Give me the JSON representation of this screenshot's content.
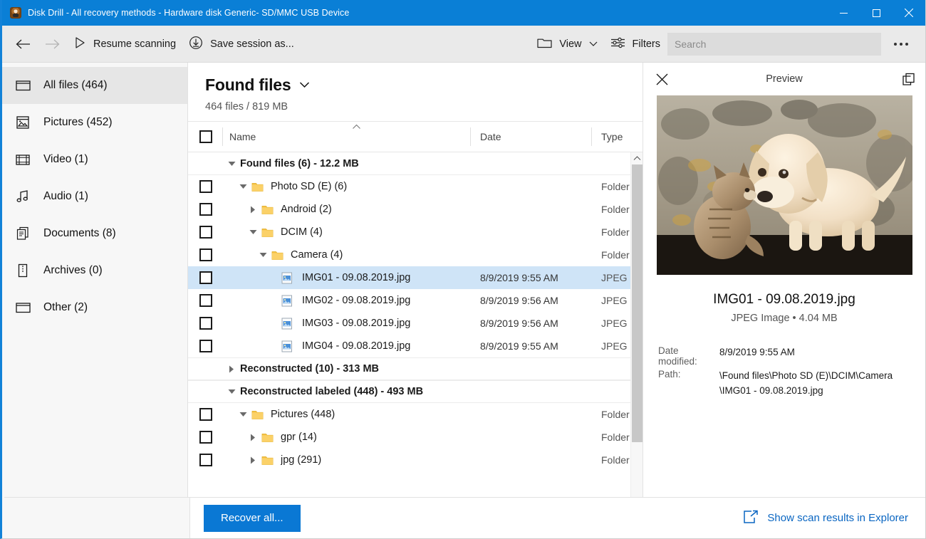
{
  "window": {
    "title": "Disk Drill - All recovery methods - Hardware disk Generic- SD/MMC USB Device",
    "minimize_label": "─",
    "maximize_label": "□",
    "close_label": "✕",
    "accent_color": "#0a7fd6"
  },
  "toolbar": {
    "back_label": "←",
    "forward_label": "→",
    "resume_label": "Resume scanning",
    "save_session_label": "Save session as...",
    "view_label": "View",
    "filters_label": "Filters",
    "search_placeholder": "Search",
    "search_value": "",
    "more_label": "•••"
  },
  "sidebar": {
    "items": [
      {
        "label": "All files (464)",
        "icon": "all-files-icon",
        "active": true
      },
      {
        "label": "Pictures (452)",
        "icon": "pictures-icon",
        "active": false
      },
      {
        "label": "Video (1)",
        "icon": "video-icon",
        "active": false
      },
      {
        "label": "Audio (1)",
        "icon": "audio-icon",
        "active": false
      },
      {
        "label": "Documents (8)",
        "icon": "documents-icon",
        "active": false
      },
      {
        "label": "Archives (0)",
        "icon": "archives-icon",
        "active": false
      },
      {
        "label": "Other (2)",
        "icon": "other-icon",
        "active": false
      }
    ]
  },
  "main": {
    "heading": "Found files",
    "heading_chevron": "⌄",
    "subheading": "464 files / 819 MB",
    "columns": {
      "name": "Name",
      "date": "Date",
      "type": "Type"
    },
    "sort_indicator": "⌃",
    "rows": [
      {
        "kind": "group",
        "indent": 0,
        "twisty": "down",
        "label": "Found files (6) - 12.2 MB",
        "date": "",
        "type": "",
        "checkbox": false,
        "selected": false,
        "first": true
      },
      {
        "kind": "folder",
        "indent": 1,
        "twisty": "down",
        "label": "Photo SD (E) (6)",
        "date": "",
        "type": "Folder",
        "checkbox": true,
        "selected": false
      },
      {
        "kind": "folder",
        "indent": 2,
        "twisty": "right",
        "label": "Android (2)",
        "date": "",
        "type": "Folder",
        "checkbox": true,
        "selected": false
      },
      {
        "kind": "folder",
        "indent": 2,
        "twisty": "down",
        "label": "DCIM (4)",
        "date": "",
        "type": "Folder",
        "checkbox": true,
        "selected": false
      },
      {
        "kind": "folder",
        "indent": 3,
        "twisty": "down",
        "label": "Camera (4)",
        "date": "",
        "type": "Folder",
        "checkbox": true,
        "selected": false
      },
      {
        "kind": "file",
        "indent": 4,
        "twisty": "none",
        "label": "IMG01 - 09.08.2019.jpg",
        "date": "8/9/2019 9:55 AM",
        "type": "JPEG I",
        "checkbox": true,
        "selected": true
      },
      {
        "kind": "file",
        "indent": 4,
        "twisty": "none",
        "label": "IMG02 - 09.08.2019.jpg",
        "date": "8/9/2019 9:56 AM",
        "type": "JPEG I",
        "checkbox": true,
        "selected": false
      },
      {
        "kind": "file",
        "indent": 4,
        "twisty": "none",
        "label": "IMG03 - 09.08.2019.jpg",
        "date": "8/9/2019 9:56 AM",
        "type": "JPEG I",
        "checkbox": true,
        "selected": false
      },
      {
        "kind": "file",
        "indent": 4,
        "twisty": "none",
        "label": "IMG04 - 09.08.2019.jpg",
        "date": "8/9/2019 9:55 AM",
        "type": "JPEG I",
        "checkbox": true,
        "selected": false
      },
      {
        "kind": "group",
        "indent": 0,
        "twisty": "right",
        "label": "Reconstructed (10) - 313 MB",
        "date": "",
        "type": "",
        "checkbox": false,
        "selected": false
      },
      {
        "kind": "group",
        "indent": 0,
        "twisty": "down",
        "label": "Reconstructed labeled (448) - 493 MB",
        "date": "",
        "type": "",
        "checkbox": false,
        "selected": false
      },
      {
        "kind": "folder",
        "indent": 1,
        "twisty": "down",
        "label": "Pictures (448)",
        "date": "",
        "type": "Folder",
        "checkbox": true,
        "selected": false
      },
      {
        "kind": "folder",
        "indent": 2,
        "twisty": "right",
        "label": "gpr (14)",
        "date": "",
        "type": "Folder",
        "checkbox": true,
        "selected": false
      },
      {
        "kind": "folder",
        "indent": 2,
        "twisty": "right",
        "label": "jpg (291)",
        "date": "",
        "type": "Folder",
        "checkbox": true,
        "selected": false
      }
    ]
  },
  "preview": {
    "title": "Preview",
    "close_label": "✕",
    "image_alt": "puppy-and-kitten-photo",
    "file_name": "IMG01 - 09.08.2019.jpg",
    "file_meta": "JPEG Image • 4.04 MB",
    "fields": [
      {
        "key": "Date modified:",
        "value": "8/9/2019 9:55 AM"
      },
      {
        "key": "Path:",
        "value": "\\Found files\\Photo SD (E)\\DCIM\\Camera\n\\IMG01 - 09.08.2019.jpg"
      }
    ]
  },
  "footer": {
    "recover_label": "Recover all...",
    "explorer_label": "Show scan results in Explorer",
    "link_color": "#0a66c2"
  }
}
